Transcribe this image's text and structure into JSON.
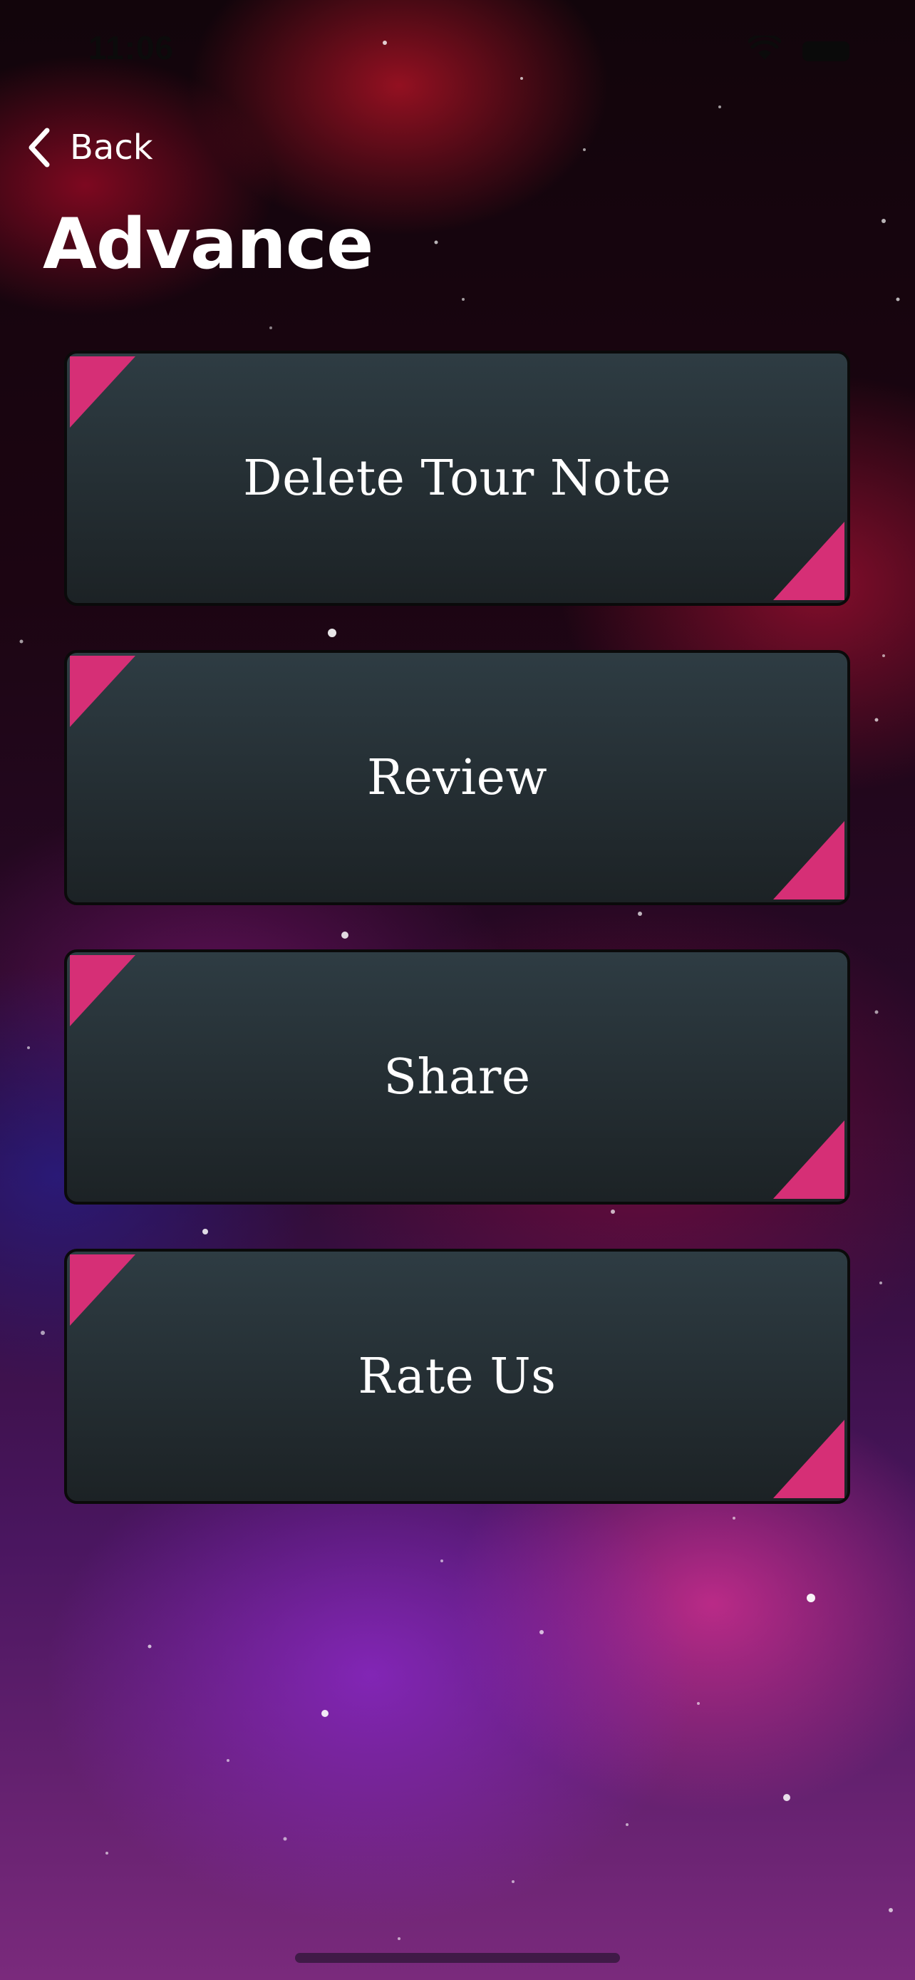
{
  "status_bar": {
    "time": "11:06",
    "wifi_icon": "wifi-icon",
    "battery_icon": "battery-icon"
  },
  "nav": {
    "back_label": "Back",
    "back_icon": "chevron-left-icon"
  },
  "page": {
    "title": "Advance"
  },
  "buttons": [
    {
      "label": "Delete Tour Note"
    },
    {
      "label": "Review"
    },
    {
      "label": "Share"
    },
    {
      "label": "Rate Us"
    }
  ],
  "colors": {
    "accent": "#d62f76",
    "button_top": "#2e3c43",
    "button_bottom": "#1c2225",
    "text": "#ffffff"
  }
}
